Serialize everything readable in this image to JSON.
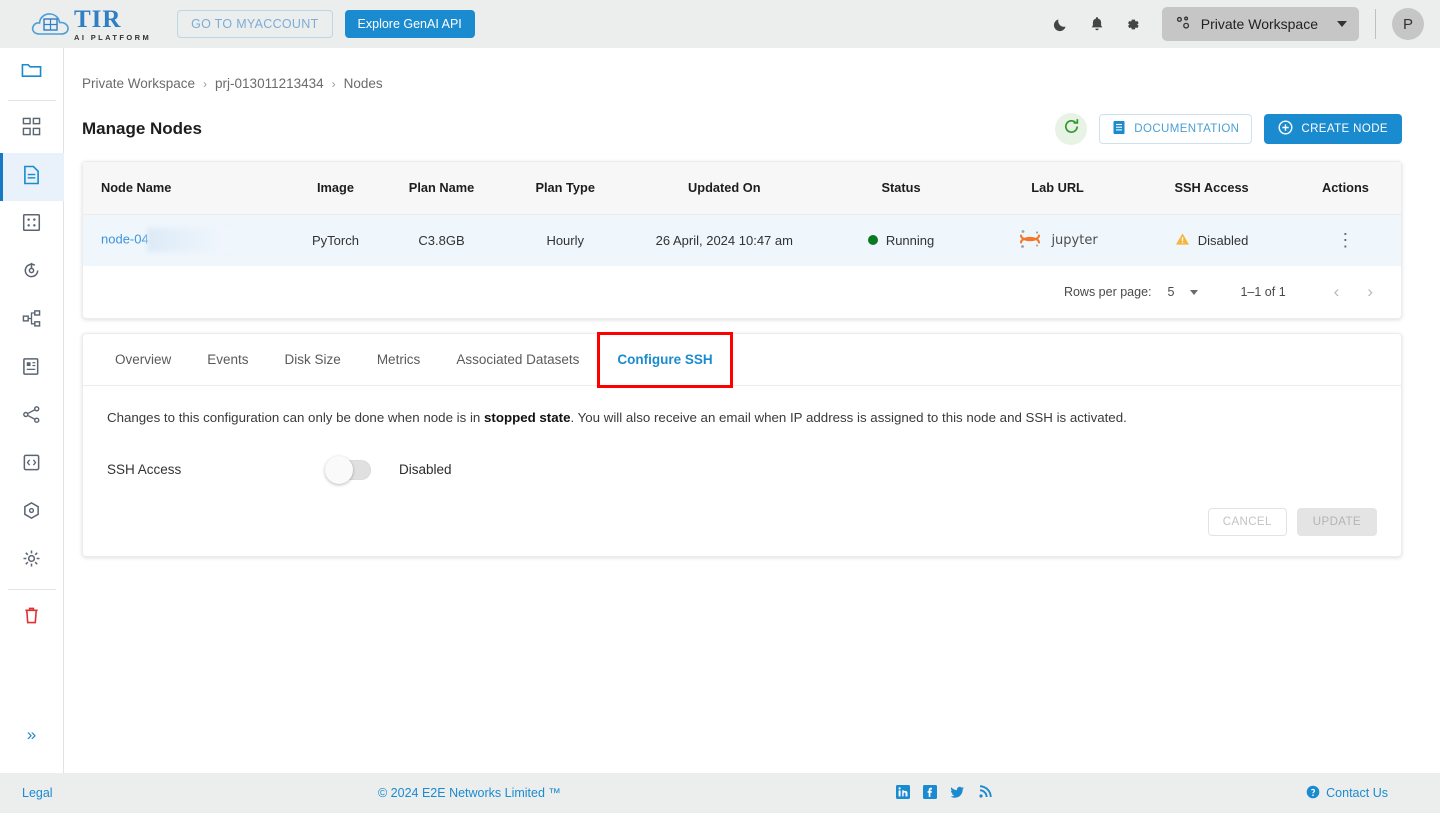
{
  "topbar": {
    "logo_title": "TIR",
    "logo_subtitle": "AI PLATFORM",
    "myaccount_label": "GO TO MYACCOUNT",
    "genai_label": "Explore GenAI API",
    "icons": [
      "dark-mode-icon",
      "notifications-icon",
      "settings-icon"
    ],
    "workspace_label": "Private Workspace",
    "avatar_initial": "P"
  },
  "sidebar": {
    "items": [
      {
        "name": "folder-icon",
        "active": false,
        "first": true
      },
      {
        "name": "dashboard-icon",
        "active": false
      },
      {
        "name": "nodes-icon",
        "active": true
      },
      {
        "name": "datasets-icon",
        "active": false
      },
      {
        "name": "inference-icon",
        "active": false
      },
      {
        "name": "pipelines-icon",
        "active": false
      },
      {
        "name": "registry-icon",
        "active": false
      },
      {
        "name": "endpoints-icon",
        "active": false
      },
      {
        "name": "code-icon",
        "active": false
      },
      {
        "name": "models-icon",
        "active": false
      },
      {
        "name": "settings-icon",
        "active": false
      }
    ],
    "trash_label": "trash-icon",
    "expand_label": "»"
  },
  "breadcrumb": {
    "items": [
      "Private Workspace",
      "prj-013011213434",
      "Nodes"
    ],
    "separator": "›"
  },
  "page": {
    "title": "Manage Nodes",
    "refresh_label": "refresh-icon",
    "documentation_label": "DOCUMENTATION",
    "create_node_label": "CREATE NODE"
  },
  "table": {
    "columns": [
      "Node Name",
      "Image",
      "Plan Name",
      "Plan Type",
      "Updated On",
      "Status",
      "Lab URL",
      "SSH Access",
      "Actions"
    ],
    "rows": [
      {
        "node_name": "node-04",
        "node_name_redacted": true,
        "image": "PyTorch",
        "plan_name": "C3.8GB",
        "plan_type": "Hourly",
        "updated_on": "26 April, 2024 10:47 am",
        "status": "Running",
        "status_color": "#0a7a22",
        "lab_url": "jupyter",
        "ssh_access": "Disabled",
        "actions": "⋮"
      }
    ]
  },
  "pagination": {
    "rows_per_page_label": "Rows per page:",
    "rows_per_page_value": "5",
    "range_label": "1–1 of 1",
    "prev_label": "‹",
    "next_label": "›"
  },
  "tabs": {
    "items": [
      {
        "label": "Overview",
        "active": false
      },
      {
        "label": "Events",
        "active": false
      },
      {
        "label": "Disk Size",
        "active": false
      },
      {
        "label": "Metrics",
        "active": false
      },
      {
        "label": "Associated Datasets",
        "active": false
      },
      {
        "label": "Configure SSH",
        "active": true
      }
    ],
    "highlight_color": "#ff0000"
  },
  "ssh_panel": {
    "notice_part1": "Changes to this configuration can only be done when node is in ",
    "notice_bold": "stopped state",
    "notice_part2": ". You will also receive an email when IP address is assigned to this node and SSH is activated.",
    "ssh_access_label": "SSH Access",
    "toggle_state": "Disabled",
    "toggle_on": false,
    "cancel_label": "CANCEL",
    "update_label": "UPDATE"
  },
  "footer": {
    "legal": "Legal",
    "copyright": "© 2024 E2E Networks Limited ™",
    "social": [
      "linkedin-icon",
      "facebook-icon",
      "twitter-icon",
      "rss-icon"
    ],
    "contact": "Contact Us"
  },
  "colors": {
    "accent": "#1b8bd0",
    "page_bg": "#eceded",
    "row_bg": "#eff6fc",
    "running_green": "#0a7a22",
    "warning_amber": "#f5b63c"
  }
}
